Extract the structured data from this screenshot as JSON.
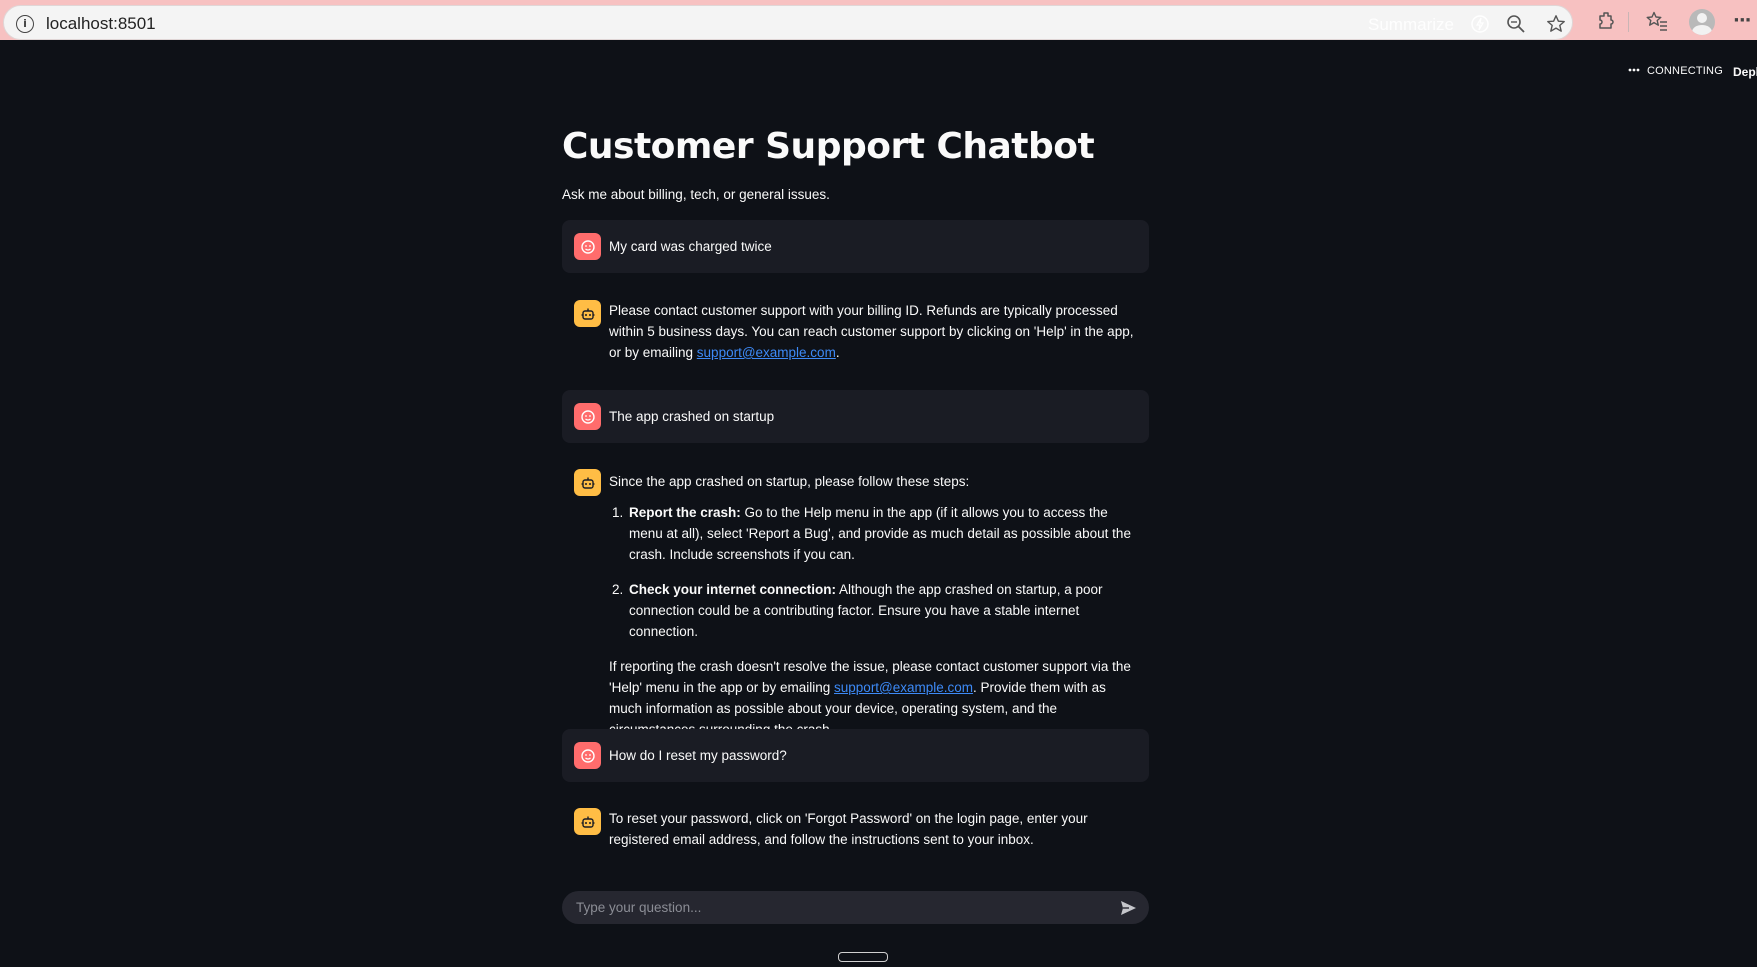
{
  "browser": {
    "url": "localhost:8501",
    "summarize_label": "Summarize"
  },
  "streamlit": {
    "status_text": "CONNECTING",
    "deploy_label": "Deploy"
  },
  "page": {
    "title": "Customer Support Chatbot",
    "subtitle": "Ask me about billing, tech, or general issues."
  },
  "messages": [
    {
      "role": "user",
      "text": "My card was charged twice"
    },
    {
      "role": "assistant",
      "text_before": "Please contact customer support with your billing ID. Refunds are typically processed within 5 business days. You can reach customer support by clicking on 'Help' in the app, or by emailing ",
      "link": "support@example.com",
      "text_after": "."
    },
    {
      "role": "user",
      "text": "The app crashed on startup"
    },
    {
      "role": "assistant",
      "intro": "Since the app crashed on startup, please follow these steps:",
      "steps": [
        {
          "num": "1.",
          "bold": "Report the crash:",
          "text": " Go to the Help menu in the app (if it allows you to access the menu at all), select 'Report a Bug', and provide as much detail as possible about the crash. Include screenshots if you can."
        },
        {
          "num": "2.",
          "bold": "Check your internet connection:",
          "text": " Although the app crashed on startup, a poor connection could be a contributing factor. Ensure you have a stable internet connection."
        }
      ],
      "outro_before": "If reporting the crash doesn't resolve the issue, please contact customer support via the 'Help' menu in the app or by emailing ",
      "outro_link": "support@example.com",
      "outro_after": ". Provide them with as much information as possible about your device, operating system, and the circumstances surrounding the crash."
    },
    {
      "role": "user",
      "text": "How do I reset my password?"
    },
    {
      "role": "assistant",
      "text": "To reset your password, click on 'Forgot Password' on the login page, enter your registered email address, and follow the instructions sent to your inbox."
    }
  ],
  "chat_input": {
    "placeholder": "Type your question..."
  },
  "colors": {
    "background": "#0e1117",
    "user_bubble": "#1a1c24",
    "user_avatar": "#ff6c6c",
    "bot_avatar": "#ffbd45",
    "link": "#3d8af7",
    "browser_bar": "#f7c1c1"
  },
  "icons": {
    "user_avatar": "face-icon",
    "bot_avatar": "robot-icon",
    "send": "send-arrow-icon"
  }
}
